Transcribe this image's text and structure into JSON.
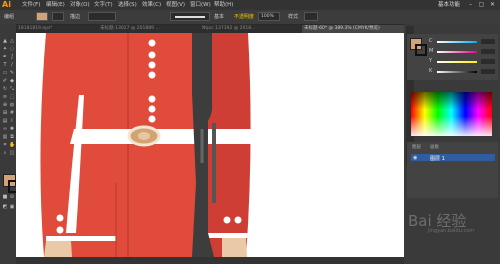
{
  "app": {
    "logo": "Ai",
    "menus": [
      "文件(F)",
      "编辑(E)",
      "对象(O)",
      "文字(T)",
      "选择(S)",
      "效果(C)",
      "视图(V)",
      "窗口(W)",
      "帮助(H)"
    ],
    "workspace_label": "基本功能",
    "window_controls": [
      "–",
      "▢",
      "✕"
    ]
  },
  "controlbar": {
    "selection_label": "编组",
    "stroke_label": "描边",
    "style_label": "基本",
    "opacity_label": "不透明度",
    "opacity_value": "100%",
    "style_label2": "样式"
  },
  "tabs": [
    {
      "label": "18181819.eps*",
      "active": false
    },
    {
      "label": "未标题-13027 @ 201889 ...",
      "active": false
    },
    {
      "label": "Ntpic 137392 @ 2018...",
      "active": false
    },
    {
      "label": "未标题-60* @ 389.3% (CMYK/预览)",
      "active": true
    }
  ],
  "colors": {
    "coat_left": "#e04b3c",
    "coat_right": "#cf3e34",
    "rifle": "#3d3d3d",
    "buckle": "#d4a373",
    "swatch_fill": "#d4a373",
    "accent": "#2f5da0"
  },
  "color_panel": {
    "channels": [
      {
        "label": "C",
        "value": "",
        "gradient": "#00aeef"
      },
      {
        "label": "M",
        "value": "",
        "gradient": "#ec008c"
      },
      {
        "label": "Y",
        "value": "",
        "gradient": "#fff200"
      },
      {
        "label": "K",
        "value": "",
        "gradient": "#000000"
      }
    ]
  },
  "layers_panel": {
    "tabs": [
      "图层",
      "画板"
    ],
    "layer_name": "图层 1"
  },
  "watermark": {
    "text": "Bai 经验",
    "sub": "jingyan.baidu.com"
  }
}
